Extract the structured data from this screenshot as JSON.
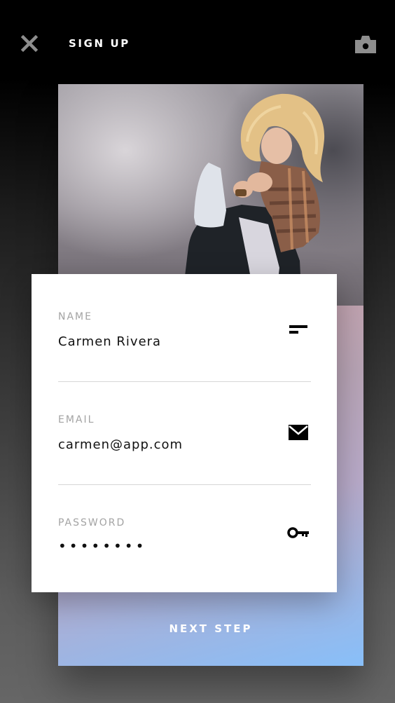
{
  "header": {
    "title": "SIGN UP",
    "close_icon": "close-icon",
    "camera_icon": "camera-icon"
  },
  "photo": {
    "description_icon": "profile-photo"
  },
  "form": {
    "fields": [
      {
        "label": "NAME",
        "value": "Carmen Rivera",
        "icon": "text-lines-icon"
      },
      {
        "label": "EMAIL",
        "value": "carmen@app.com",
        "icon": "envelope-icon"
      },
      {
        "label": "PASSWORD",
        "value": "••••••••",
        "icon": "key-icon"
      }
    ]
  },
  "footer": {
    "next_label": "NEXT STEP"
  },
  "colors": {
    "gradient_start": "#d7a1a3",
    "gradient_end": "#88bff9",
    "label_gray": "#a3a3a3",
    "text_dark": "#111111"
  }
}
